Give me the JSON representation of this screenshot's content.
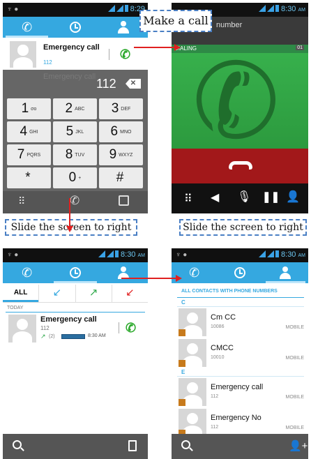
{
  "callouts": {
    "make_call": "Make a call",
    "slide1": "Slide the screen to right",
    "slide2": "Slide the screen to right"
  },
  "status": {
    "time1": "8:29",
    "time2": "8:30",
    "am": "AM"
  },
  "dialer": {
    "entry_name": "Emergency call",
    "entry_number": "112",
    "ghost_name": "Emergency call",
    "display": "112",
    "keys": [
      {
        "d": "1",
        "s": "σο"
      },
      {
        "d": "2",
        "s": "ABC"
      },
      {
        "d": "3",
        "s": "DEF"
      },
      {
        "d": "4",
        "s": "GHI"
      },
      {
        "d": "5",
        "s": "JKL"
      },
      {
        "d": "6",
        "s": "MNO"
      },
      {
        "d": "7",
        "s": "PQRS"
      },
      {
        "d": "8",
        "s": "TUV"
      },
      {
        "d": "9",
        "s": "WXYZ"
      },
      {
        "d": "*",
        "s": ""
      },
      {
        "d": "0",
        "s": "+"
      },
      {
        "d": "#",
        "s": ""
      }
    ]
  },
  "call": {
    "header": "number",
    "state": "DIALING",
    "badge": "01"
  },
  "log": {
    "filters": [
      "ALL",
      "↙",
      "↗",
      "↙"
    ],
    "section": "TODAY",
    "name": "Emergency call",
    "number": "112",
    "count": "(2)",
    "time": "8:30 AM"
  },
  "contacts": {
    "header": "ALL CONTACTS WITH PHONE NUMBERS",
    "items": [
      {
        "sec": "C",
        "name": "Cm CC",
        "num": "10086",
        "type": "MOBILE"
      },
      {
        "sec": "",
        "name": "CMCC",
        "num": "10010",
        "type": "MOBILE"
      },
      {
        "sec": "E",
        "name": "Emergency call",
        "num": "112",
        "type": "MOBILE"
      },
      {
        "sec": "",
        "name": "Emergency No",
        "num": "112",
        "type": "MOBILE"
      }
    ]
  },
  "colors": {
    "accent": "#35a8e0",
    "green": "#2ea84a",
    "red": "#a2181a",
    "arrow": "#e02020"
  }
}
